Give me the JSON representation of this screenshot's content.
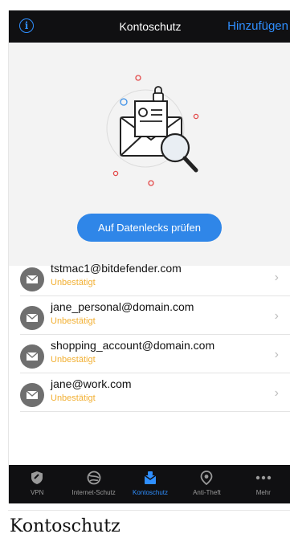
{
  "header": {
    "title": "Kontoschutz",
    "add_label": "Hinzufügen",
    "info_glyph": "i"
  },
  "hero": {
    "button_label": "Auf Datenlecks prüfen",
    "illustration_icon": "magnifier-envelope-icon"
  },
  "accounts": [
    {
      "email": "tstmac1@bitdefender.com",
      "status": "Unbestätigt"
    },
    {
      "email": "jane_personal@domain.com",
      "status": "Unbestätigt"
    },
    {
      "email": "shopping_account@domain.com",
      "status": "Unbestätigt"
    },
    {
      "email": "jane@work.com",
      "status": "Unbestätigt"
    }
  ],
  "tabs": [
    {
      "label": "VPN",
      "icon": "shield-icon"
    },
    {
      "label": "Internet-Schutz",
      "icon": "globe-icon"
    },
    {
      "label": "Kontoschutz",
      "icon": "account-protection-icon"
    },
    {
      "label": "Anti-Theft",
      "icon": "location-pin-icon"
    },
    {
      "label": "Mehr",
      "icon": "more-dots-icon"
    }
  ],
  "caption": "Kontoschutz",
  "colors": {
    "accent": "#2f8fff",
    "button": "#2f86e8",
    "status": "#f2b033",
    "bar": "#101012"
  }
}
